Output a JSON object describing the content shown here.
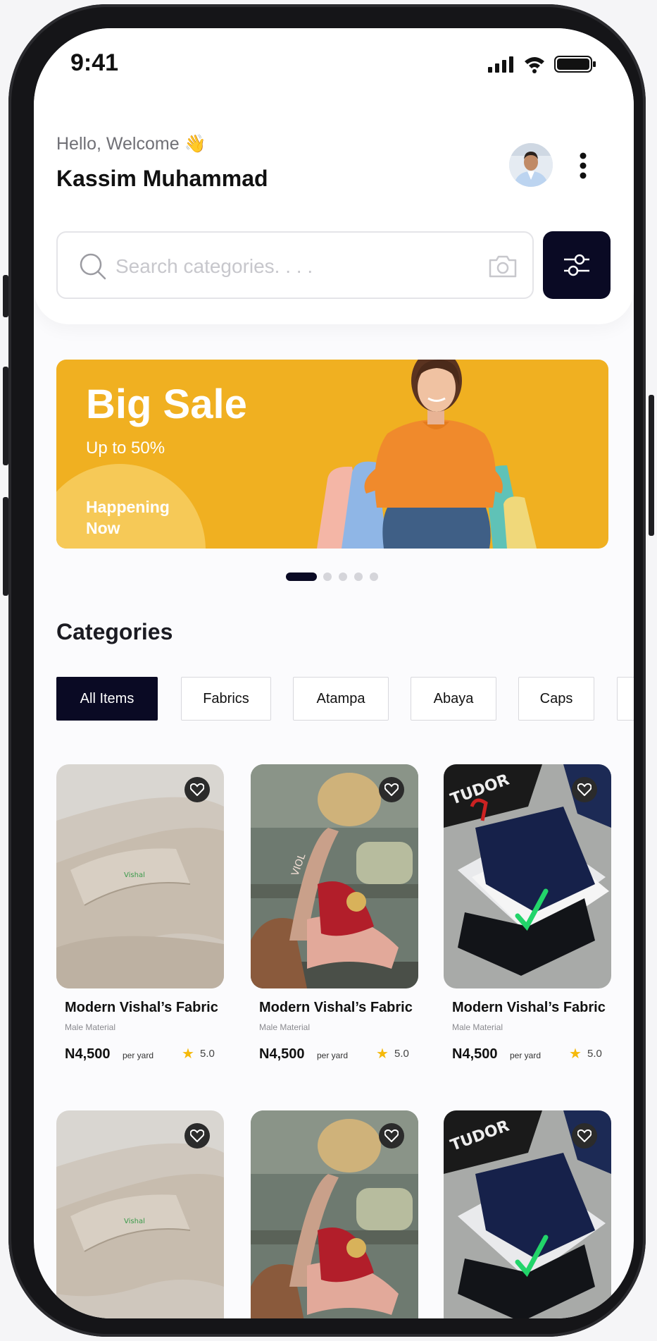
{
  "status_bar": {
    "time": "9:41"
  },
  "header": {
    "greeting": "Hello, Welcome 👋",
    "user_name": "Kassim Muhammad"
  },
  "search": {
    "placeholder": "Search categories. . . ."
  },
  "banner": {
    "title": "Big Sale",
    "subtitle": "Up to 50%",
    "cta": "Happening Now",
    "active_slide": 1,
    "slide_count": 5
  },
  "categories": {
    "title": "Categories",
    "chips": [
      "All Items",
      "Fabrics",
      "Atampa",
      "Abaya",
      "Caps"
    ],
    "active": "All Items"
  },
  "products": [
    {
      "name": "Modern Vishal’s Fabric",
      "material": "Male Material",
      "price": "N4,500",
      "unit": "per yard",
      "rating": "5.0"
    },
    {
      "name": "Modern Vishal’s Fabric",
      "material": "Male Material",
      "price": "N4,500",
      "unit": "per yard",
      "rating": "5.0"
    },
    {
      "name": "Modern Vishal’s Fabric",
      "material": "Male Material",
      "price": "N4,500",
      "unit": "per yard",
      "rating": "5.0"
    }
  ],
  "colors": {
    "accent": "#0a0a24",
    "banner": "#f0b021",
    "star": "#f5b90a"
  }
}
